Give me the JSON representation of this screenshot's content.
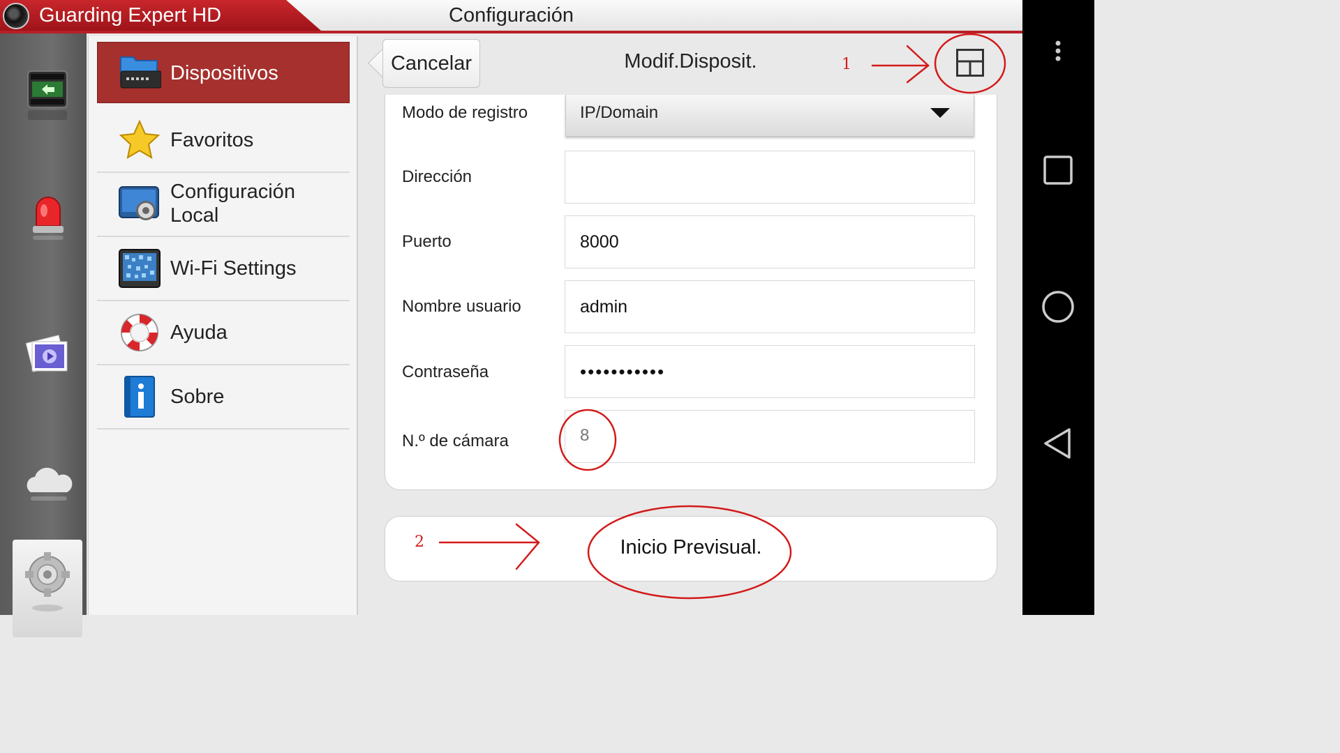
{
  "app": {
    "name": "Guarding Expert HD",
    "page_title": "Configuración"
  },
  "rail": {
    "items": [
      {
        "icon": "playback-icon"
      },
      {
        "icon": "alarm-icon"
      },
      {
        "icon": "media-gallery-icon"
      },
      {
        "icon": "cloud-icon"
      },
      {
        "icon": "settings-gear-icon"
      }
    ]
  },
  "menu": {
    "items": [
      {
        "label": "Dispositivos",
        "icon": "dvr-device-icon",
        "active": true
      },
      {
        "label": "Favoritos",
        "icon": "star-icon"
      },
      {
        "label": "Configuración Local",
        "line1": "Configuración",
        "line2": "Local",
        "icon": "local-config-icon"
      },
      {
        "label": "Wi-Fi Settings",
        "icon": "wifi-qr-icon"
      },
      {
        "label": "Ayuda",
        "icon": "lifebuoy-icon"
      },
      {
        "label": "Sobre",
        "icon": "info-book-icon"
      }
    ]
  },
  "form": {
    "cancel_label": "Cancelar",
    "title": "Modif.Disposit.",
    "layout_icon": "layout-grid-icon",
    "fields": [
      {
        "label": "Modo de registro",
        "value": "IP/Domain",
        "type": "select"
      },
      {
        "label": "Dirección",
        "value": ""
      },
      {
        "label": "Puerto",
        "value": "8000"
      },
      {
        "label": "Nombre usuario",
        "value": "admin"
      },
      {
        "label": "Contraseña",
        "value": "•••••••••••",
        "type": "password"
      },
      {
        "label": "N.º de cámara",
        "value": "8"
      }
    ],
    "start_label": "Inicio Previsual."
  },
  "annotations": {
    "marker_1": "1",
    "marker_2": "2",
    "color": "#d31a1a"
  },
  "colors": {
    "brand_red": "#a5302d",
    "accent_red": "#b81f25"
  }
}
